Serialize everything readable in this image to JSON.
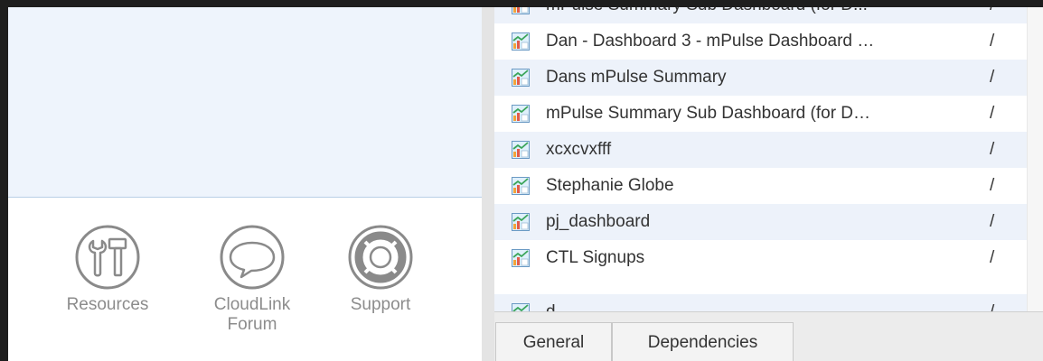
{
  "left_panel": {
    "links": [
      {
        "label": "Resources"
      },
      {
        "label": "CloudLink\nForum"
      },
      {
        "label": "Support"
      }
    ]
  },
  "dashboard_list": {
    "rows": [
      {
        "name": "mPulse Summary Sub Dashboard (for D...",
        "path": "/"
      },
      {
        "name": "Dan - Dashboard 3 - mPulse Dashboard …",
        "path": "/"
      },
      {
        "name": "Dans mPulse Summary",
        "path": "/"
      },
      {
        "name": "mPulse Summary Sub Dashboard (for D…",
        "path": "/"
      },
      {
        "name": "xcxcvxfff",
        "path": "/"
      },
      {
        "name": "Stephanie Globe",
        "path": "/"
      },
      {
        "name": "pj_dashboard",
        "path": "/"
      },
      {
        "name": "CTL Signups",
        "path": "/"
      },
      {
        "name": "d...",
        "path": "/"
      }
    ]
  },
  "tabs": [
    {
      "label": "General"
    },
    {
      "label": "Dependencies"
    }
  ]
}
